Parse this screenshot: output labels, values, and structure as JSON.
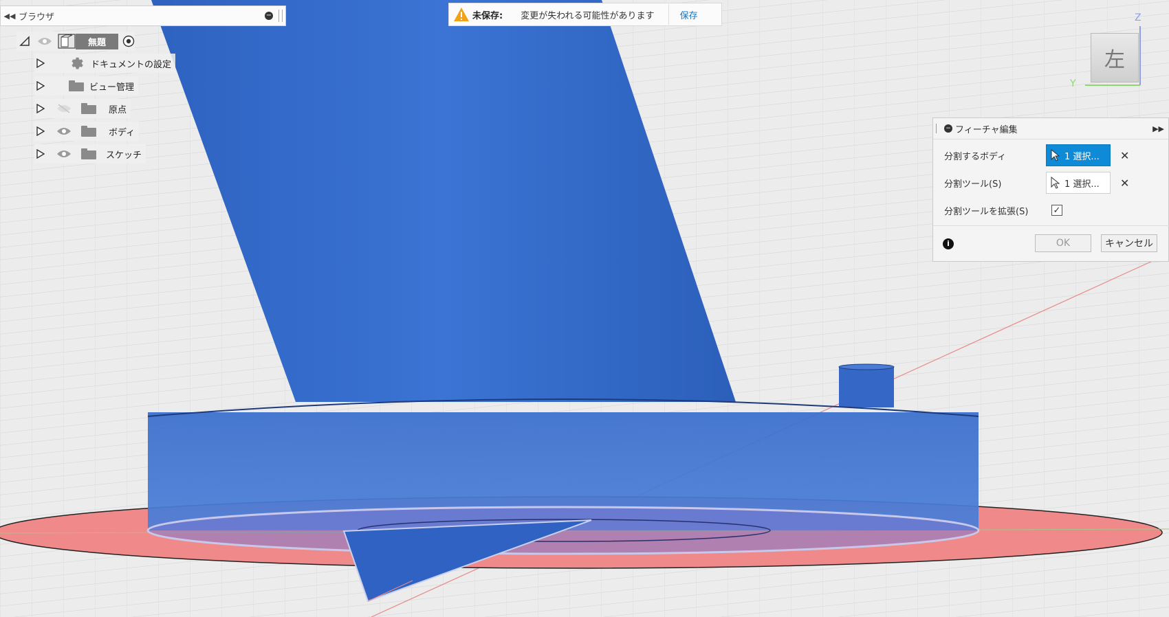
{
  "browser": {
    "title": "ブラウザ",
    "root": {
      "label": "無題"
    },
    "items": [
      {
        "label": "ドキュメントの設定",
        "icon": "gear-icon"
      },
      {
        "label": "ビュー管理",
        "icon": "folder-icon"
      },
      {
        "label": "原点",
        "icon": "folder-icon",
        "visibility": "hidden"
      },
      {
        "label": "ボディ",
        "icon": "folder-icon",
        "visibility": "visible"
      },
      {
        "label": "スケッチ",
        "icon": "folder-icon",
        "visibility": "visible"
      }
    ]
  },
  "unsaved_bar": {
    "label": "未保存:",
    "message": "変更が失われる可能性があります",
    "save_label": "保存"
  },
  "viewcube": {
    "face_label": "左",
    "axis_z": "Z",
    "axis_y": "Y"
  },
  "dialog": {
    "title": "フィーチャ編集",
    "rows": [
      {
        "label": "分割するボディ",
        "value": "1 選択...",
        "state": "active"
      },
      {
        "label": "分割ツール(S)",
        "value": "1 選択..."
      },
      {
        "label": "分割ツールを拡張(S)",
        "checked": true
      }
    ],
    "ok_label": "OK",
    "cancel_label": "キャンセル"
  },
  "colors": {
    "model_blue": "#2f6fcf",
    "plane_red": "#f08a8a",
    "accent_blue": "#0f8ad6",
    "background": "#f0f0f0"
  }
}
